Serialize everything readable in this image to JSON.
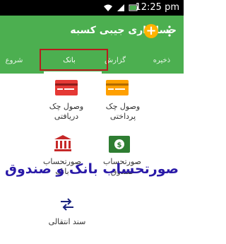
{
  "status": {
    "time": "12:25 pm"
  },
  "app": {
    "title": "حسابداری جیبی کسبه",
    "add_label": "+"
  },
  "tabs": [
    {
      "label": "ذخیره"
    },
    {
      "label": "گزارش"
    },
    {
      "label": "بانک"
    },
    {
      "label": "شروع"
    }
  ],
  "items": {
    "check_paid": {
      "line1": "وصول چک",
      "line2": "پرداختی"
    },
    "check_received": {
      "line1": "وصول چک",
      "line2": "دریافتی"
    },
    "cash_statement": {
      "line1": "صورتحساب",
      "line2": "صندوق"
    },
    "bank_statement": {
      "line1": "صورتحساب",
      "line2": "بانک"
    },
    "transfer": {
      "line1": "سند انتقالی"
    }
  },
  "overlay_text": "صورتحساب بانک و صندوق",
  "colors": {
    "appbar": "#4caf50",
    "accent": "#ffb300",
    "highlight": "#b71c1c",
    "overlay": "#2a1aa8"
  }
}
